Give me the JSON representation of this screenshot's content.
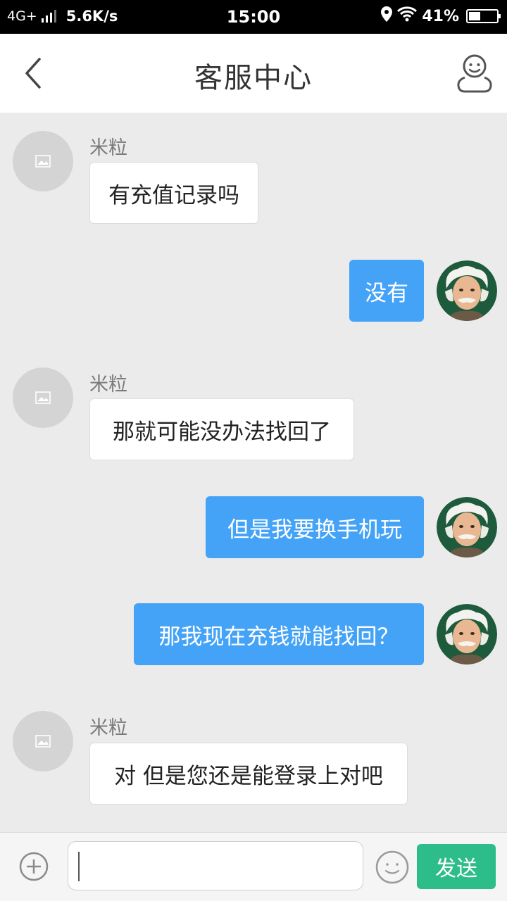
{
  "status_bar": {
    "network": "4G+",
    "speed": "5.6K/s",
    "time": "15:00",
    "battery": "41%",
    "battery_level": 0.41
  },
  "header": {
    "title": "客服中心",
    "back_icon": "chevron-left-icon",
    "profile_icon": "user-profile-icon"
  },
  "messages": [
    {
      "direction": "incoming",
      "sender": "米粒",
      "text": "有充值记录吗"
    },
    {
      "direction": "outgoing",
      "text": "没有"
    },
    {
      "direction": "incoming",
      "sender": "米粒",
      "text": "那就可能没办法找回了"
    },
    {
      "direction": "outgoing",
      "text": "但是我要换手机玩"
    },
    {
      "direction": "outgoing",
      "text": "那我现在充钱就能找回？"
    },
    {
      "direction": "incoming",
      "sender": "米粒",
      "text": "对 但是您还是能登录上对吧"
    }
  ],
  "input_bar": {
    "input_value": "",
    "send_label": "发送",
    "plus_icon": "plus-circle-icon",
    "emoji_icon": "emoji-icon"
  },
  "colors": {
    "outgoing_bubble": "#44a3f7",
    "send_button": "#2dbd8a",
    "background": "#ebebeb"
  }
}
